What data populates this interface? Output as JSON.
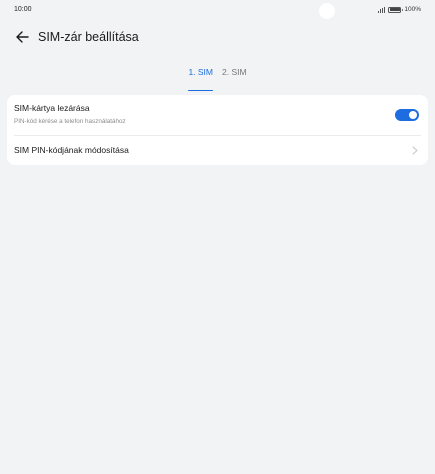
{
  "status_bar": {
    "time": "10:00",
    "battery": "100%",
    "battery_level": 1.0,
    "icons": [
      "signal-icon",
      "battery-icon"
    ]
  },
  "header": {
    "title": "SIM-zár beállítása",
    "back_icon": "arrow-left-icon"
  },
  "tabs": [
    {
      "label": "1. SIM",
      "active": true
    },
    {
      "label": "2. SIM",
      "active": false
    }
  ],
  "settings": [
    {
      "title": "SIM-kártya lezárása",
      "subtitle": "PIN-kód kérése a telefon használatához",
      "control": "toggle",
      "toggle_on": true
    },
    {
      "title": "SIM PIN-kódjának módosítása",
      "control": "chevron-right-icon"
    }
  ],
  "colors": {
    "accent": "#1e6de0",
    "background": "#f1f3f5",
    "card": "#ffffff"
  }
}
